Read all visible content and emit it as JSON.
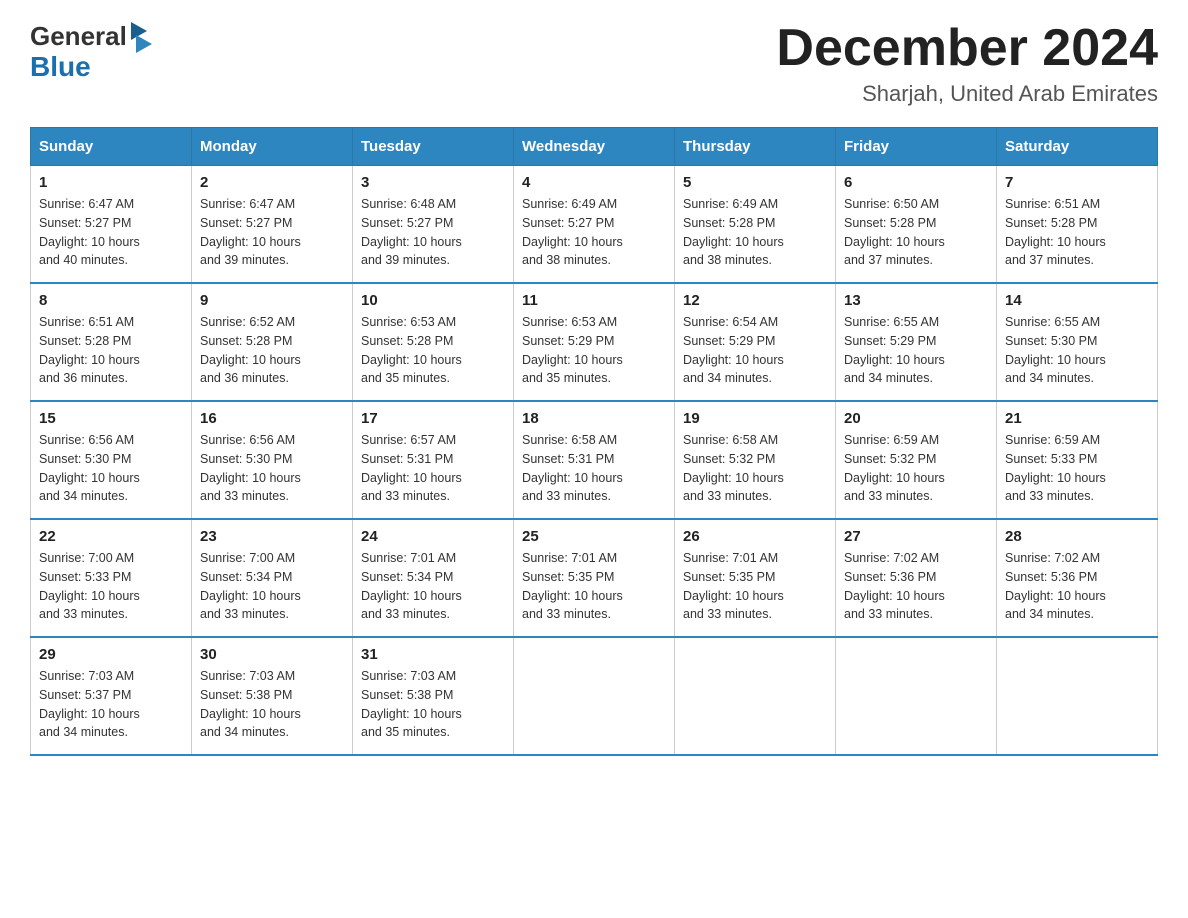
{
  "header": {
    "logo_general": "General",
    "logo_blue": "Blue",
    "month_title": "December 2024",
    "subtitle": "Sharjah, United Arab Emirates"
  },
  "days_of_week": [
    "Sunday",
    "Monday",
    "Tuesday",
    "Wednesday",
    "Thursday",
    "Friday",
    "Saturday"
  ],
  "weeks": [
    [
      {
        "day": "1",
        "sunrise": "6:47 AM",
        "sunset": "5:27 PM",
        "daylight": "10 hours and 40 minutes."
      },
      {
        "day": "2",
        "sunrise": "6:47 AM",
        "sunset": "5:27 PM",
        "daylight": "10 hours and 39 minutes."
      },
      {
        "day": "3",
        "sunrise": "6:48 AM",
        "sunset": "5:27 PM",
        "daylight": "10 hours and 39 minutes."
      },
      {
        "day": "4",
        "sunrise": "6:49 AM",
        "sunset": "5:27 PM",
        "daylight": "10 hours and 38 minutes."
      },
      {
        "day": "5",
        "sunrise": "6:49 AM",
        "sunset": "5:28 PM",
        "daylight": "10 hours and 38 minutes."
      },
      {
        "day": "6",
        "sunrise": "6:50 AM",
        "sunset": "5:28 PM",
        "daylight": "10 hours and 37 minutes."
      },
      {
        "day": "7",
        "sunrise": "6:51 AM",
        "sunset": "5:28 PM",
        "daylight": "10 hours and 37 minutes."
      }
    ],
    [
      {
        "day": "8",
        "sunrise": "6:51 AM",
        "sunset": "5:28 PM",
        "daylight": "10 hours and 36 minutes."
      },
      {
        "day": "9",
        "sunrise": "6:52 AM",
        "sunset": "5:28 PM",
        "daylight": "10 hours and 36 minutes."
      },
      {
        "day": "10",
        "sunrise": "6:53 AM",
        "sunset": "5:28 PM",
        "daylight": "10 hours and 35 minutes."
      },
      {
        "day": "11",
        "sunrise": "6:53 AM",
        "sunset": "5:29 PM",
        "daylight": "10 hours and 35 minutes."
      },
      {
        "day": "12",
        "sunrise": "6:54 AM",
        "sunset": "5:29 PM",
        "daylight": "10 hours and 34 minutes."
      },
      {
        "day": "13",
        "sunrise": "6:55 AM",
        "sunset": "5:29 PM",
        "daylight": "10 hours and 34 minutes."
      },
      {
        "day": "14",
        "sunrise": "6:55 AM",
        "sunset": "5:30 PM",
        "daylight": "10 hours and 34 minutes."
      }
    ],
    [
      {
        "day": "15",
        "sunrise": "6:56 AM",
        "sunset": "5:30 PM",
        "daylight": "10 hours and 34 minutes."
      },
      {
        "day": "16",
        "sunrise": "6:56 AM",
        "sunset": "5:30 PM",
        "daylight": "10 hours and 33 minutes."
      },
      {
        "day": "17",
        "sunrise": "6:57 AM",
        "sunset": "5:31 PM",
        "daylight": "10 hours and 33 minutes."
      },
      {
        "day": "18",
        "sunrise": "6:58 AM",
        "sunset": "5:31 PM",
        "daylight": "10 hours and 33 minutes."
      },
      {
        "day": "19",
        "sunrise": "6:58 AM",
        "sunset": "5:32 PM",
        "daylight": "10 hours and 33 minutes."
      },
      {
        "day": "20",
        "sunrise": "6:59 AM",
        "sunset": "5:32 PM",
        "daylight": "10 hours and 33 minutes."
      },
      {
        "day": "21",
        "sunrise": "6:59 AM",
        "sunset": "5:33 PM",
        "daylight": "10 hours and 33 minutes."
      }
    ],
    [
      {
        "day": "22",
        "sunrise": "7:00 AM",
        "sunset": "5:33 PM",
        "daylight": "10 hours and 33 minutes."
      },
      {
        "day": "23",
        "sunrise": "7:00 AM",
        "sunset": "5:34 PM",
        "daylight": "10 hours and 33 minutes."
      },
      {
        "day": "24",
        "sunrise": "7:01 AM",
        "sunset": "5:34 PM",
        "daylight": "10 hours and 33 minutes."
      },
      {
        "day": "25",
        "sunrise": "7:01 AM",
        "sunset": "5:35 PM",
        "daylight": "10 hours and 33 minutes."
      },
      {
        "day": "26",
        "sunrise": "7:01 AM",
        "sunset": "5:35 PM",
        "daylight": "10 hours and 33 minutes."
      },
      {
        "day": "27",
        "sunrise": "7:02 AM",
        "sunset": "5:36 PM",
        "daylight": "10 hours and 33 minutes."
      },
      {
        "day": "28",
        "sunrise": "7:02 AM",
        "sunset": "5:36 PM",
        "daylight": "10 hours and 34 minutes."
      }
    ],
    [
      {
        "day": "29",
        "sunrise": "7:03 AM",
        "sunset": "5:37 PM",
        "daylight": "10 hours and 34 minutes."
      },
      {
        "day": "30",
        "sunrise": "7:03 AM",
        "sunset": "5:38 PM",
        "daylight": "10 hours and 34 minutes."
      },
      {
        "day": "31",
        "sunrise": "7:03 AM",
        "sunset": "5:38 PM",
        "daylight": "10 hours and 35 minutes."
      },
      null,
      null,
      null,
      null
    ]
  ],
  "labels": {
    "sunrise": "Sunrise:",
    "sunset": "Sunset:",
    "daylight": "Daylight:"
  }
}
